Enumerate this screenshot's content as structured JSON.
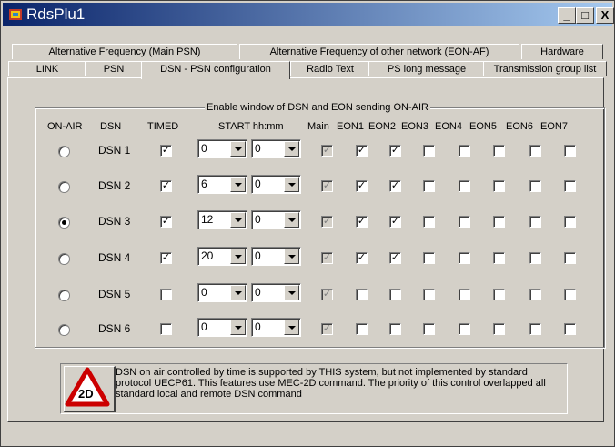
{
  "window": {
    "title": "RdsPlu1",
    "minimize": "_",
    "maximize": "□",
    "close": "X"
  },
  "tabs_top": [
    "Alternative Frequency (Main PSN)",
    "Alternative Frequency of other network (EON-AF)",
    "Hardware"
  ],
  "tabs_bottom": [
    "LINK",
    "PSN",
    "DSN - PSN configuration",
    "Radio Text",
    "PS long message",
    "Transmission group list"
  ],
  "active_tab": "DSN - PSN configuration",
  "group": {
    "title": "Enable window of DSN and EON sending ON-AIR",
    "headers": {
      "onair": "ON-AIR",
      "dsn": "DSN",
      "timed": "TIMED",
      "start": "START hh:mm",
      "main": "Main",
      "eon": [
        "EON1",
        "EON2",
        "EON3",
        "EON4",
        "EON5",
        "EON6",
        "EON7"
      ]
    },
    "rows": [
      {
        "dsn": "DSN 1",
        "onair": false,
        "timed": true,
        "hh": "0",
        "mm": "0",
        "main": true,
        "eon": [
          true,
          true,
          false,
          false,
          false,
          false,
          false
        ]
      },
      {
        "dsn": "DSN 2",
        "onair": false,
        "timed": true,
        "hh": "6",
        "mm": "0",
        "main": true,
        "eon": [
          true,
          true,
          false,
          false,
          false,
          false,
          false
        ]
      },
      {
        "dsn": "DSN 3",
        "onair": true,
        "timed": true,
        "hh": "12",
        "mm": "0",
        "main": true,
        "eon": [
          true,
          true,
          false,
          false,
          false,
          false,
          false
        ]
      },
      {
        "dsn": "DSN 4",
        "onair": false,
        "timed": true,
        "hh": "20",
        "mm": "0",
        "main": true,
        "eon": [
          true,
          true,
          false,
          false,
          false,
          false,
          false
        ]
      },
      {
        "dsn": "DSN 5",
        "onair": false,
        "timed": false,
        "hh": "0",
        "mm": "0",
        "main": true,
        "eon": [
          false,
          false,
          false,
          false,
          false,
          false,
          false
        ]
      },
      {
        "dsn": "DSN 6",
        "onair": false,
        "timed": false,
        "hh": "0",
        "mm": "0",
        "main": true,
        "eon": [
          false,
          false,
          false,
          false,
          false,
          false,
          false
        ]
      }
    ]
  },
  "notice": {
    "badge": "2D",
    "lines": [
      "DSN on air controlled by time is supported by THIS system, but not implemented by standard",
      "protocol UECP61. This features use MEC-2D command. The priority of this control overlapped all",
      "standard local and remote DSN command"
    ]
  },
  "check_glyph": "✓",
  "colors": {
    "titlebar_start": "#0a246a",
    "titlebar_end": "#a6caf0",
    "face": "#d4d0c8",
    "badge_red": "#cc0000"
  }
}
